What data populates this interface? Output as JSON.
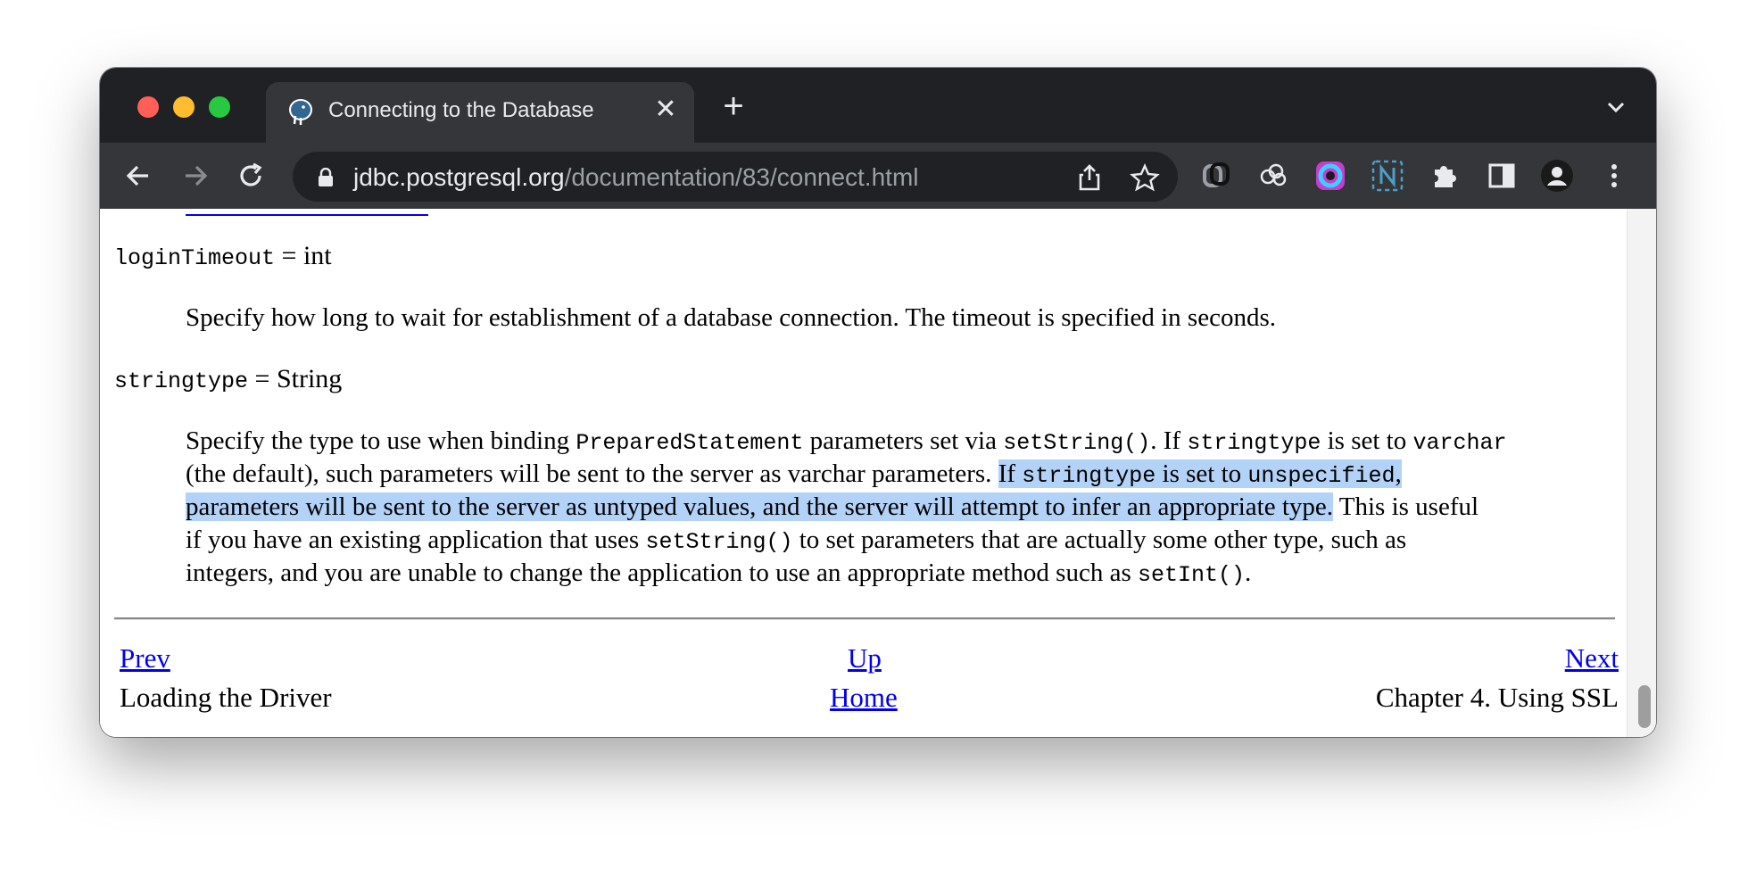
{
  "browser": {
    "tab_title": "Connecting to the Database",
    "tab_close": "✕",
    "new_tab": "+",
    "url_host": "jdbc.postgresql.org",
    "url_path": "/documentation/83/connect.html",
    "icons": {
      "favicon": "postgresql-elephant-icon",
      "back": "back-arrow-icon",
      "forward": "forward-arrow-icon",
      "reload": "reload-icon",
      "lock": "lock-icon",
      "share": "share-icon",
      "bookmark": "star-icon",
      "extensions": [
        "link-extension-icon",
        "cloud-extension-icon",
        "color-wheel-extension-icon",
        "n-extension-icon"
      ],
      "puzzle": "extensions-puzzle-icon",
      "sidepanel": "side-panel-icon",
      "profile": "profile-avatar-icon",
      "menu": "kebab-menu-icon",
      "tab_search": "chevron-down-icon"
    }
  },
  "doc": {
    "login_timeout": {
      "name": "loginTimeout",
      "eq_type": " = int",
      "description": "Specify how long to wait for establishment of a database connection. The timeout is specified in seconds."
    },
    "stringtype": {
      "name": "stringtype",
      "eq_type": " = String",
      "lines": {
        "l1_a": "Specify the type to use when binding ",
        "l1_code1": "PreparedStatement",
        "l1_b": " parameters set via ",
        "l1_code2": "setString()",
        "l1_c": ". If ",
        "l1_code3": "stringtype",
        "l1_d": " is set to ",
        "l1_code4": "varchar",
        "l2_a": "(the default), such parameters will be sent to the server as varchar parameters. ",
        "l2_hl_a": "If ",
        "l2_hl_code1": "stringtype",
        "l2_hl_b": " is set to ",
        "l2_hl_code2": "unspecified",
        "l2_hl_c": ",",
        "l3_hl": "parameters will be sent to the server as untyped values, and the server will attempt to infer an appropriate type.",
        "l3_b": " This is useful",
        "l4_a": "if you have an existing application that uses ",
        "l4_code": "setString()",
        "l4_b": " to set parameters that are actually some other type, such as",
        "l5_a": "integers, and you are unable to change the application to use an appropriate method such as ",
        "l5_code": "setInt()",
        "l5_b": "."
      }
    }
  },
  "footer_nav": {
    "prev": "Prev",
    "up": "Up",
    "next": "Next",
    "prev_title": "Loading the Driver",
    "home": "Home",
    "next_title": "Chapter 4. Using SSL"
  },
  "colors": {
    "selection": "#b3d2f7",
    "link": "#0000ee",
    "chrome_dark": "#202124",
    "chrome_tab": "#35363a"
  }
}
